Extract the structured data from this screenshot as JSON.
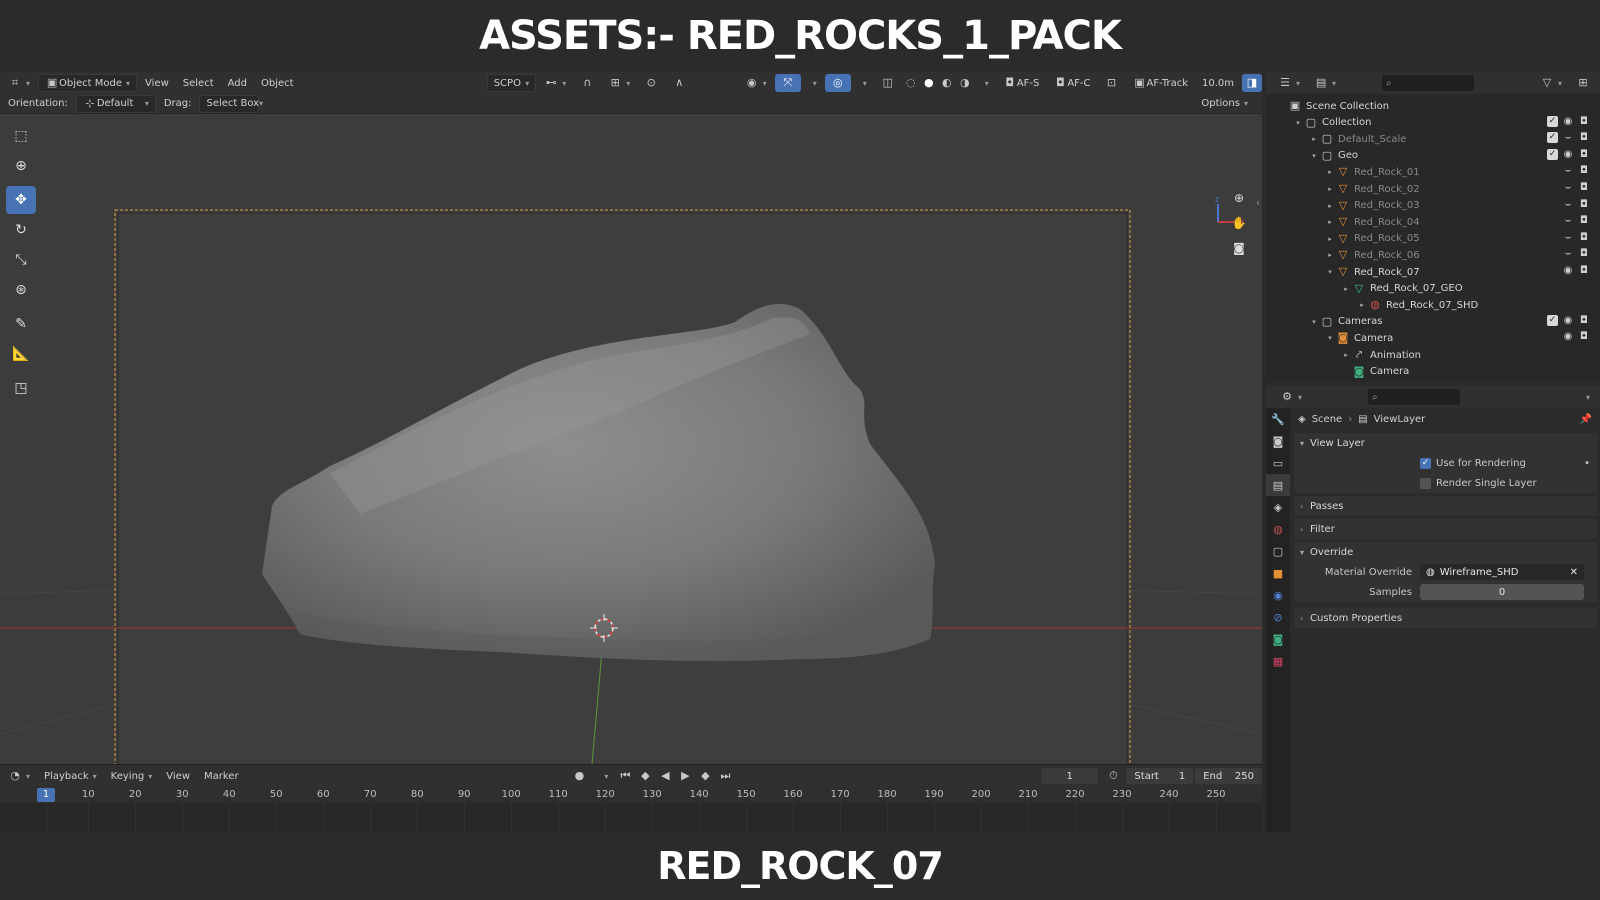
{
  "banner": {
    "top_title": "ASSETS:- RED_ROCKS_1_PACK",
    "bottom_title": "RED_ROCK_07"
  },
  "viewport_header": {
    "mode": "Object Mode",
    "menus": [
      "View",
      "Select",
      "Add",
      "Object"
    ],
    "transform_orientation": "SCPO",
    "af_s": "AF-S",
    "af_c": "AF-C",
    "af_track": "AF-Track",
    "distance": "10.0m"
  },
  "viewport_subheader": {
    "orientation_label": "Orientation:",
    "orientation_value": "Default",
    "drag_label": "Drag:",
    "drag_value": "Select Box",
    "options": "Options"
  },
  "timeline": {
    "menus": [
      "Playback",
      "Keying",
      "View",
      "Marker"
    ],
    "current_frame": "1",
    "start_label": "Start",
    "start_value": "1",
    "end_label": "End",
    "end_value": "250",
    "ticks": [
      "1",
      "10",
      "20",
      "30",
      "40",
      "50",
      "60",
      "70",
      "80",
      "90",
      "100",
      "110",
      "120",
      "130",
      "140",
      "150",
      "160",
      "170",
      "180",
      "190",
      "200",
      "210",
      "220",
      "230",
      "240",
      "250"
    ]
  },
  "outliner": {
    "rows": [
      {
        "label": "Scene Collection",
        "indent": 0,
        "icon": "scene-collection-icon",
        "dim": false
      },
      {
        "label": "Collection",
        "indent": 1,
        "icon": "collection-icon",
        "dim": false
      },
      {
        "label": "Default_Scale",
        "indent": 2,
        "icon": "collection-icon",
        "dim": true
      },
      {
        "label": "Geo",
        "indent": 2,
        "icon": "collection-icon",
        "dim": false
      },
      {
        "label": "Red_Rock_01",
        "indent": 3,
        "icon": "mesh-object-icon",
        "dim": true
      },
      {
        "label": "Red_Rock_02",
        "indent": 3,
        "icon": "mesh-object-icon",
        "dim": true
      },
      {
        "label": "Red_Rock_03",
        "indent": 3,
        "icon": "mesh-object-icon",
        "dim": true
      },
      {
        "label": "Red_Rock_04",
        "indent": 3,
        "icon": "mesh-object-icon",
        "dim": true
      },
      {
        "label": "Red_Rock_05",
        "indent": 3,
        "icon": "mesh-object-icon",
        "dim": true
      },
      {
        "label": "Red_Rock_06",
        "indent": 3,
        "icon": "mesh-object-icon",
        "dim": true
      },
      {
        "label": "Red_Rock_07",
        "indent": 3,
        "icon": "mesh-object-icon",
        "dim": false
      },
      {
        "label": "Red_Rock_07_GEO",
        "indent": 4,
        "icon": "mesh-data-icon",
        "dim": false
      },
      {
        "label": "Red_Rock_07_SHD",
        "indent": 5,
        "icon": "material-icon",
        "dim": false
      },
      {
        "label": "Cameras",
        "indent": 2,
        "icon": "collection-icon",
        "dim": false
      },
      {
        "label": "Camera",
        "indent": 3,
        "icon": "camera-object-icon",
        "dim": false
      },
      {
        "label": "Animation",
        "indent": 4,
        "icon": "animation-icon",
        "dim": false
      },
      {
        "label": "Camera",
        "indent": 4,
        "icon": "camera-data-icon",
        "dim": false
      }
    ]
  },
  "properties": {
    "breadcrumb_scene": "Scene",
    "breadcrumb_viewlayer": "ViewLayer",
    "view_layer_title": "View Layer",
    "use_for_rendering": "Use for Rendering",
    "render_single_layer": "Render Single Layer",
    "passes": "Passes",
    "filter": "Filter",
    "override": "Override",
    "material_override_label": "Material Override",
    "material_override_value": "Wireframe_SHD",
    "samples_label": "Samples",
    "samples_value": "0",
    "custom_properties": "Custom Properties"
  },
  "colors": {
    "accent": "#4772b3",
    "camera_frame": "#e0a040",
    "x_axis": "#b03a3a",
    "y_axis": "#5c9a3a"
  }
}
